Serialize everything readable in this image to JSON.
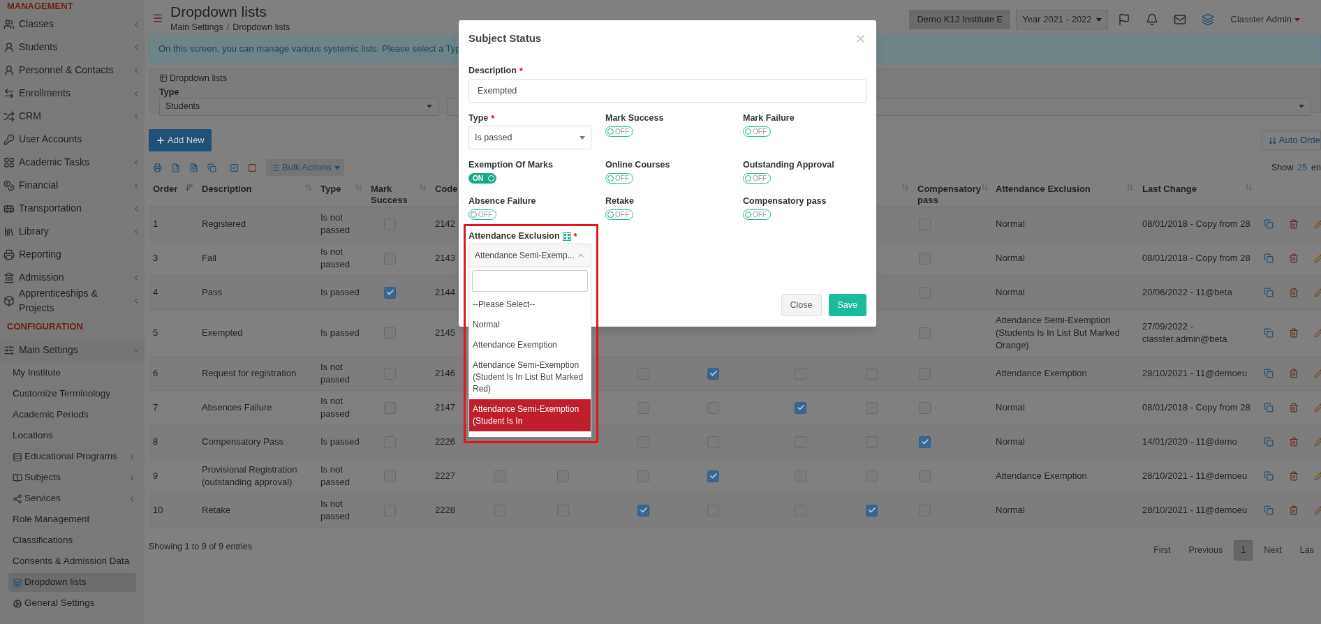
{
  "sidebar": {
    "sections": [
      {
        "title": "MANAGEMENT",
        "items": [
          {
            "label": "Classes",
            "submenu": true,
            "expanded": false
          },
          {
            "label": "Students",
            "submenu": true,
            "expanded": false
          },
          {
            "label": "Personnel & Contacts",
            "submenu": true,
            "expanded": false
          },
          {
            "label": "Enrollments",
            "submenu": true,
            "expanded": false
          },
          {
            "label": "CRM",
            "submenu": true,
            "expanded": false
          },
          {
            "label": "User Accounts",
            "submenu": false
          },
          {
            "label": "Academic Tasks",
            "submenu": true,
            "expanded": false
          },
          {
            "label": "Financial",
            "submenu": true,
            "expanded": false
          },
          {
            "label": "Transportation",
            "submenu": true,
            "expanded": false
          },
          {
            "label": "Library",
            "submenu": true,
            "expanded": false
          },
          {
            "label": "Reporting",
            "submenu": false
          },
          {
            "label": "Admission",
            "submenu": true,
            "expanded": false
          },
          {
            "label": "Apprenticeships & Projects",
            "submenu": true,
            "expanded": false
          }
        ]
      },
      {
        "title": "CONFIGURATION",
        "items": [
          {
            "label": "Main Settings",
            "submenu": true,
            "expanded": true,
            "children": [
              {
                "label": "My Institute",
                "submenu": false,
                "selected": false
              },
              {
                "label": "Customize Terminology",
                "submenu": false,
                "selected": false
              },
              {
                "label": "Academic Periods",
                "submenu": false,
                "selected": false
              },
              {
                "label": "Locations",
                "submenu": false,
                "selected": false
              },
              {
                "label": "Educational Programs",
                "submenu": true,
                "selected": false
              },
              {
                "label": "Subjects",
                "submenu": true,
                "selected": false
              },
              {
                "label": "Services",
                "submenu": true,
                "selected": false
              },
              {
                "label": "Role Management",
                "submenu": false,
                "selected": false
              },
              {
                "label": "Classifications",
                "submenu": false,
                "selected": false
              },
              {
                "label": "Consents & Admission Data",
                "submenu": false,
                "selected": false
              },
              {
                "label": "Dropdown lists",
                "submenu": false,
                "selected": true
              },
              {
                "label": "General Settings",
                "submenu": false,
                "selected": false
              }
            ]
          }
        ]
      }
    ]
  },
  "header": {
    "title": "Dropdown lists",
    "breadcrumb": [
      "Main Settings",
      "Dropdown lists"
    ],
    "breadcrumb_separator": "/",
    "institute": "Demo K12 Institute E",
    "year": "Year 2021 - 2022",
    "user": "Classter Admin"
  },
  "info": "On this screen, you can manage various systemic lists. Please select a Typ",
  "filter_panel": {
    "title": "Dropdown lists",
    "type_label": "Type",
    "type_value": "Students"
  },
  "toolbar": {
    "add_label": "Add New",
    "auto_order": "Auto Orde",
    "bulk_actions": "Bulk Actions",
    "show_label": "Show",
    "page_size": "25",
    "show_suffix": "en"
  },
  "table": {
    "columns": [
      {
        "kind": "text",
        "label": "Order",
        "sorted": true
      },
      {
        "kind": "text",
        "label": "Description",
        "sorted": false
      },
      {
        "kind": "text",
        "label": "Type",
        "sorted": false
      },
      {
        "kind": "check",
        "label": "Mark Success",
        "sorted": false
      },
      {
        "kind": "text",
        "label": "Code"
      },
      {
        "kind": "check"
      },
      {
        "kind": "check"
      },
      {
        "kind": "check"
      },
      {
        "kind": "check"
      },
      {
        "kind": "check"
      },
      {
        "kind": "check",
        "sorted": false
      },
      {
        "kind": "check",
        "label": "Compensatory pass",
        "sorted": false
      },
      {
        "kind": "text",
        "label": "Attendance Exclusion",
        "sorted": false
      },
      {
        "kind": "text",
        "label": "Last Change",
        "sorted": false
      },
      {
        "kind": "actions"
      }
    ],
    "rows": [
      {
        "cells": [
          "1",
          "Registered",
          "Is not passed",
          {
            "checked": false
          },
          "2142",
          null,
          null,
          null,
          null,
          null,
          null,
          {
            "checked": false
          },
          "Normal",
          "08/01/2018 - Copy from 28"
        ]
      },
      {
        "cells": [
          "3",
          "Fail",
          "Is not passed",
          {
            "checked": false
          },
          "2143",
          null,
          null,
          null,
          null,
          null,
          null,
          {
            "checked": false
          },
          "Normal",
          "08/01/2018 - Copy from 28"
        ]
      },
      {
        "cells": [
          "4",
          "Pass",
          "Is passed",
          {
            "checked": true
          },
          "2144",
          null,
          null,
          null,
          null,
          null,
          null,
          {
            "checked": false
          },
          "Normal",
          "20/06/2022 - 11@beta"
        ]
      },
      {
        "cells": [
          "5",
          "Exempted",
          "Is passed",
          {
            "checked": false
          },
          "2145",
          null,
          null,
          null,
          null,
          null,
          null,
          {
            "checked": false
          },
          "Attendance Semi-Exemption (Students Is In List But Marked Orange)",
          "27/09/2022 - classter.admin@beta"
        ]
      },
      {
        "cells": [
          "6",
          "Request for registration",
          "Is not passed",
          {
            "checked": false
          },
          "2146",
          null,
          null,
          {
            "checked": false
          },
          {
            "checked": true
          },
          {
            "checked": false
          },
          {
            "checked": false
          },
          {
            "checked": false
          },
          "Attendance Exemption",
          "28/10/2021 - 11@demoeu"
        ]
      },
      {
        "cells": [
          "7",
          "Absences Failure",
          "Is not passed",
          {
            "checked": false
          },
          "2147",
          null,
          null,
          {
            "checked": false
          },
          {
            "checked": false
          },
          {
            "checked": true
          },
          {
            "checked": false
          },
          {
            "checked": false
          },
          "Normal",
          "08/01/2018 - Copy from 28"
        ]
      },
      {
        "cells": [
          "8",
          "Compensatory Pass",
          "Is passed",
          {
            "checked": false
          },
          "2226",
          null,
          null,
          {
            "checked": false
          },
          {
            "checked": false
          },
          {
            "checked": false
          },
          {
            "checked": false
          },
          {
            "checked": true
          },
          "Normal",
          "14/01/2020 - 11@demo"
        ]
      },
      {
        "cells": [
          "9",
          "Provisional Registration (outstanding approval)",
          "Is not passed",
          {
            "checked": false
          },
          "2227",
          {
            "checked": false
          },
          {
            "checked": false
          },
          {
            "checked": false
          },
          {
            "checked": true
          },
          {
            "checked": false
          },
          {
            "checked": false
          },
          {
            "checked": false
          },
          "Attendance Exemption",
          "28/10/2021 - 11@demoeu"
        ]
      },
      {
        "cells": [
          "10",
          "Retake",
          "Is not passed",
          {
            "checked": false
          },
          "2228",
          {
            "checked": false
          },
          {
            "checked": false
          },
          {
            "checked": true
          },
          {
            "checked": false
          },
          {
            "checked": false
          },
          {
            "checked": true
          },
          {
            "checked": false
          },
          "Normal",
          "28/10/2021 - 11@demoeu"
        ]
      }
    ],
    "summary": "Showing 1 to 9 of 9 entries",
    "pagination": [
      {
        "label": "First",
        "selected": false
      },
      {
        "label": "Previous",
        "selected": false
      },
      {
        "label": "1",
        "selected": true
      },
      {
        "label": "Next",
        "selected": false
      },
      {
        "label": "Las",
        "selected": false
      }
    ]
  },
  "modal": {
    "title": "Subject Status",
    "required_mark": "*",
    "description": {
      "label": "Description",
      "required": true,
      "value": "Exempted"
    },
    "type": {
      "label": "Type",
      "required": true,
      "value": "Is passed"
    },
    "toggles": [
      {
        "label": "Mark Success",
        "on": false,
        "state_text": "OFF"
      },
      {
        "label": "Mark Failure",
        "on": false,
        "state_text": "OFF"
      },
      {
        "label": "Exemption Of Marks",
        "on": true,
        "state_text": "ON"
      },
      {
        "label": "Online Courses",
        "on": false,
        "state_text": "OFF"
      },
      {
        "label": "Outstanding Approval",
        "on": false,
        "state_text": "OFF"
      },
      {
        "label": "Absence Failure",
        "on": false,
        "state_text": "OFF"
      },
      {
        "label": "Retake",
        "on": false,
        "state_text": "OFF"
      },
      {
        "label": "Compensatory pass",
        "on": false,
        "state_text": "OFF"
      }
    ],
    "attendance": {
      "label": "Attendance Exclusion",
      "required": true,
      "value": "Attendance Semi-Exemp...",
      "open": true,
      "options": [
        {
          "label": "--Please Select--",
          "selected": false
        },
        {
          "label": "Normal",
          "selected": false
        },
        {
          "label": "Attendance Exemption",
          "selected": false
        },
        {
          "label": "Attendance Semi-Exemption (Student Is In List But Marked Red)",
          "selected": false
        },
        {
          "label": "Attendance Semi-Exemption (Student Is In",
          "selected": true
        }
      ]
    },
    "close_label": "Close",
    "save_label": "Save"
  }
}
